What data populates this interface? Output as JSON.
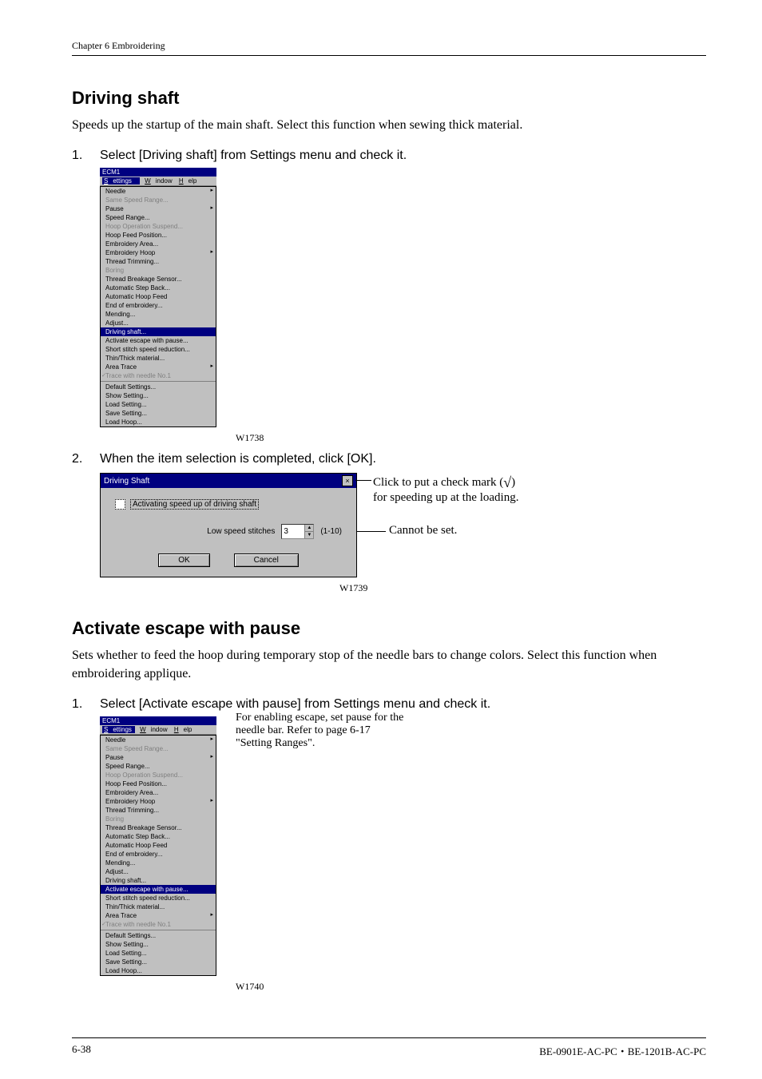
{
  "header": {
    "chapter": "Chapter 6    Embroidering"
  },
  "section1": {
    "title": "Driving shaft",
    "intro": "Speeds up the startup of the main shaft.    Select this function when sewing thick material.",
    "step1": "Select [Driving shaft] from Settings menu and check it.",
    "step2": "When the item selection is completed, click [OK].",
    "fig1_caption": "W1738",
    "fig2_caption": "W1739"
  },
  "menu1": {
    "menu_active": "Settings",
    "menu_window": "Window",
    "menu_help": "Help",
    "titlebar": "ECM1",
    "highlight": "Driving shaft...",
    "items": {
      "needle": "Needle",
      "ssr": "Same Speed Range...",
      "pause": "Pause",
      "speed_range": "Speed Range...",
      "hoop_cr": "Hoop Operation Suspend...",
      "hoop_feed_pos": "Hoop Feed Position...",
      "emb_area": "Embroidery Area...",
      "emb_hoop": "Embroidery Hoop",
      "thread_trim": "Thread Trimming...",
      "boring": "Boring",
      "tbs": "Thread Breakage Sensor...",
      "asb": "Automatic Step Back...",
      "ahf": "Automatic Hoop Feed",
      "eoe": "End of embroidery...",
      "mending": "Mending...",
      "adjust": "Adjust...",
      "aewp": "Activate escape with pause...",
      "sssr": "Short stitch speed reduction...",
      "ttm": "Thin/Thick material...",
      "area_trace": "Area Trace",
      "twn1": "Trace with needle No.1",
      "def_set": "Default Settings...",
      "show_set": "Show Setting...",
      "load_set": "Load Setting...",
      "save_set": "Save Setting...",
      "load_hoop": "Load Hoop..."
    }
  },
  "dialog": {
    "title": "Driving Shaft",
    "checkbox_label": "Activating speed up of driving shaft",
    "low_label": "Low speed stitches",
    "low_value": "3",
    "low_range": "(1-10)",
    "ok": "OK",
    "cancel": "Cancel"
  },
  "annotations": {
    "a1_line1": "Click to put a check mark (",
    "a1_symbol": "√",
    "a1_line1_end": ")",
    "a1_line2": "for speeding up at the loading.",
    "a2": "Cannot be set."
  },
  "section2": {
    "title": "Activate escape with pause",
    "intro": "Sets whether to feed the hoop during temporary stop of the needle bars to change colors.    Select this function when embroidering applique.",
    "step1": "Select [Activate escape with pause] from Settings menu and check it.",
    "fig_caption": "W1740",
    "side_note_l1": "For enabling escape, set pause for the",
    "side_note_l2": "needle bar. Refer to page 6-17",
    "side_note_l3": "\"Setting Ranges\"."
  },
  "menu2": {
    "highlight": "Activate escape with pause..."
  },
  "footer": {
    "left": "6-38",
    "right": "BE-0901E-AC-PC・BE-1201B-AC-PC"
  }
}
